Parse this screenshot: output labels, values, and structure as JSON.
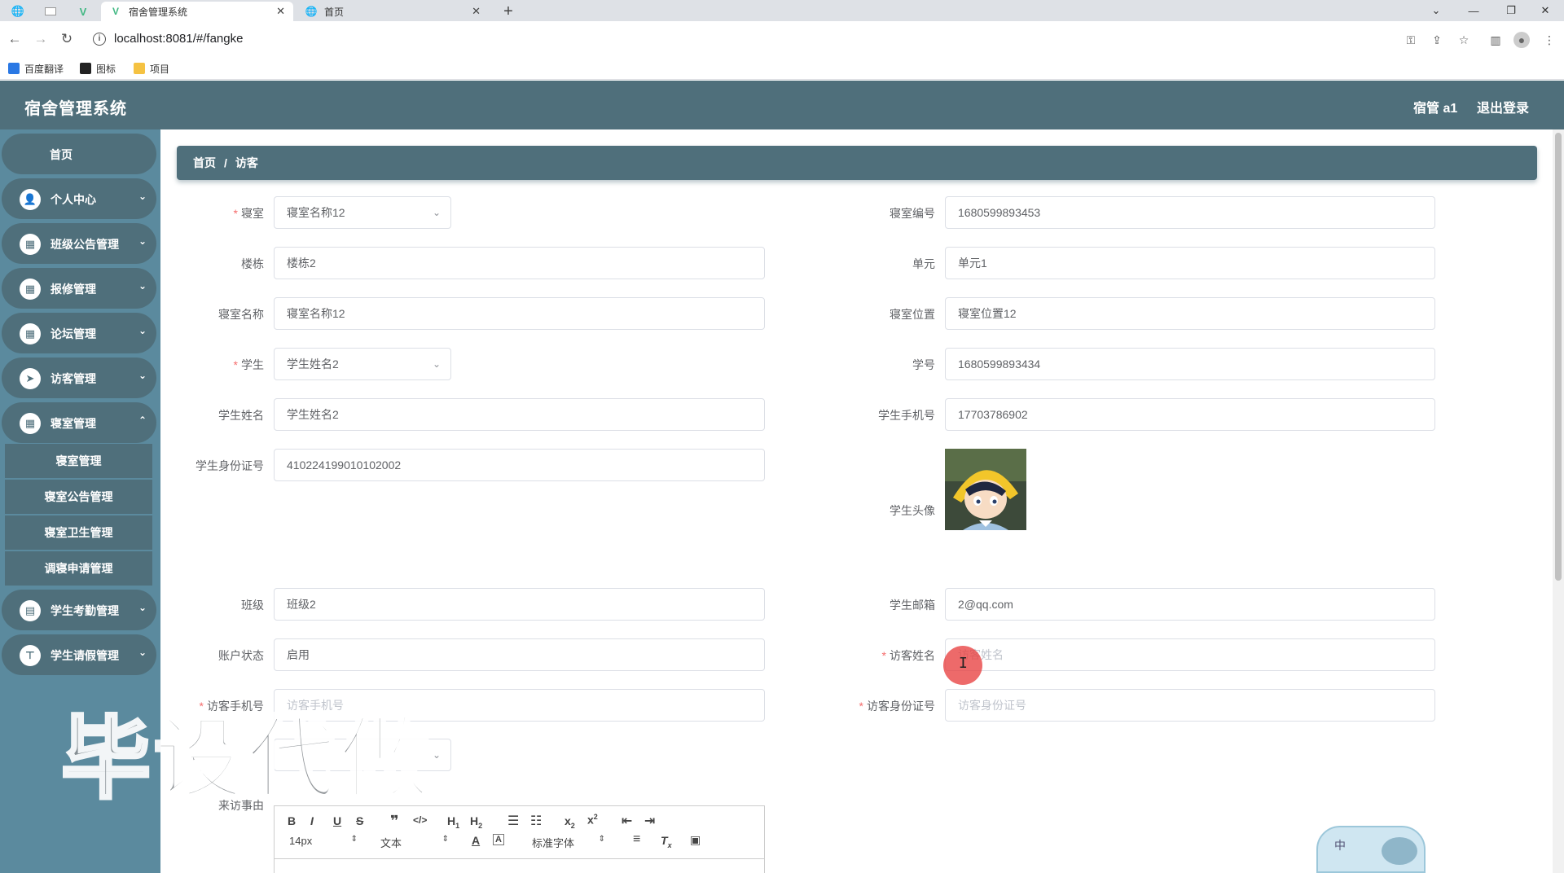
{
  "browser": {
    "tabs": [
      {
        "title": "宿舍管理系统",
        "active": true
      },
      {
        "title": "首页",
        "active": false
      }
    ],
    "url": "localhost:8081/#/fangke",
    "bookmarks": [
      "百度翻译",
      "图标",
      "项目"
    ]
  },
  "header": {
    "title": "宿舍管理系统",
    "user": "宿管 a1",
    "logout": "退出登录"
  },
  "sidebar": {
    "home": "首页",
    "items": [
      {
        "label": "个人中心",
        "icon": "user-icon"
      },
      {
        "label": "班级公告管理",
        "icon": "grid-icon"
      },
      {
        "label": "报修管理",
        "icon": "grid-icon"
      },
      {
        "label": "论坛管理",
        "icon": "grid-icon"
      },
      {
        "label": "访客管理",
        "icon": "send-icon"
      },
      {
        "label": "寝室管理",
        "icon": "grid-icon"
      }
    ],
    "submenu": [
      "寝室管理",
      "寝室公告管理",
      "寝室卫生管理",
      "调寝申请管理"
    ],
    "items_after": [
      {
        "label": "学生考勤管理",
        "icon": "clipboard-icon"
      },
      {
        "label": "学生请假管理",
        "icon": "stamp-icon"
      }
    ]
  },
  "breadcrumb": {
    "home": "首页",
    "sep": "/",
    "current": "访客"
  },
  "form": {
    "dorm": {
      "label": "寝室",
      "value": "寝室名称12"
    },
    "dorm_no": {
      "label": "寝室编号",
      "value": "1680599893453"
    },
    "building": {
      "label": "楼栋",
      "value": "楼栋2"
    },
    "unit": {
      "label": "单元",
      "value": "单元1"
    },
    "dorm_name": {
      "label": "寝室名称",
      "value": "寝室名称12"
    },
    "dorm_location": {
      "label": "寝室位置",
      "value": "寝室位置12"
    },
    "student": {
      "label": "学生",
      "value": "学生姓名2"
    },
    "student_no": {
      "label": "学号",
      "value": "1680599893434"
    },
    "student_name": {
      "label": "学生姓名",
      "value": "学生姓名2"
    },
    "student_phone": {
      "label": "学生手机号",
      "value": "17703786902"
    },
    "student_id": {
      "label": "学生身份证号",
      "value": "410224199010102002"
    },
    "student_avatar": {
      "label": "学生头像"
    },
    "class": {
      "label": "班级",
      "value": "班级2"
    },
    "student_email": {
      "label": "学生邮箱",
      "value": "2@qq.com"
    },
    "account_status": {
      "label": "账户状态",
      "value": "启用"
    },
    "visitor_name": {
      "label": "访客姓名",
      "placeholder": "访客姓名"
    },
    "visitor_phone": {
      "label": "访客手机号",
      "placeholder": "访客手机号"
    },
    "visitor_id": {
      "label": "访客身份证号",
      "placeholder": "访客身份证号"
    },
    "reason": {
      "label": "来访事由"
    }
  },
  "editor": {
    "font_size": "14px",
    "block_type": "文本",
    "font_family": "标准字体"
  },
  "watermark": "毕设代做",
  "ime_label": "中"
}
